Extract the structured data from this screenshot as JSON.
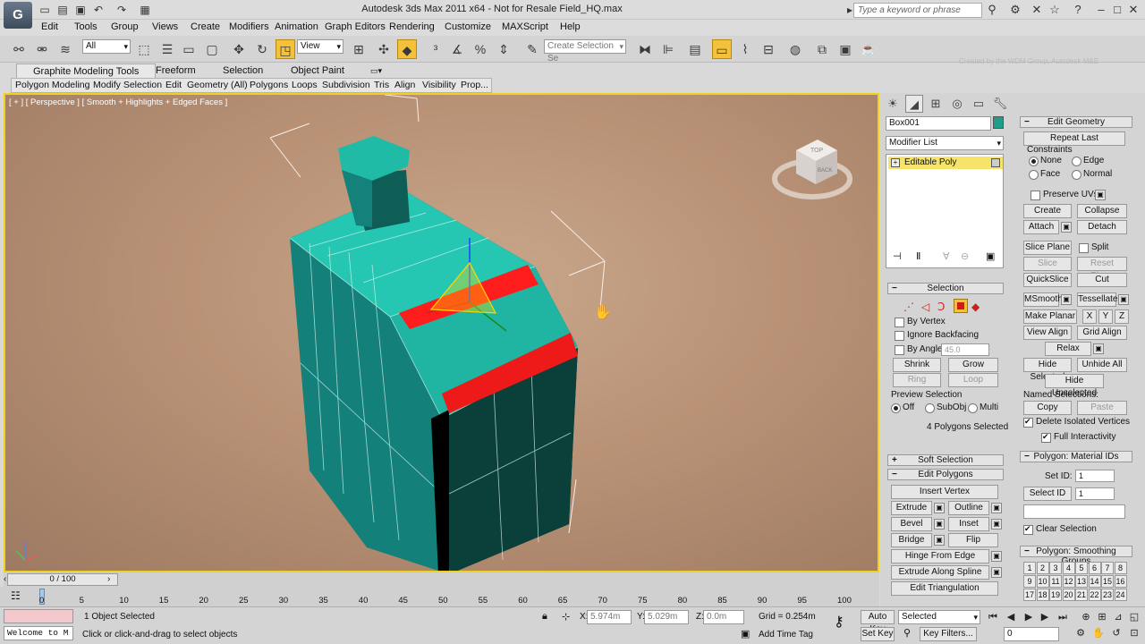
{
  "app": {
    "title": "Autodesk 3ds Max  2011 x64    -  Not for Resale    Field_HQ.max",
    "search_placeholder": "Type a keyword or phrase",
    "watermark": "Created by the WDM Group, Autodesk M&E"
  },
  "menu": [
    "Edit",
    "Tools",
    "Group",
    "Views",
    "Create",
    "Modifiers",
    "Animation",
    "Graph Editors",
    "Rendering",
    "Customize",
    "MAXScript",
    "Help"
  ],
  "toolbar": {
    "filter_value": "All",
    "refcoord_value": "View",
    "selection_set_placeholder": "Create Selection Se"
  },
  "ribbon": {
    "tabs": [
      "Graphite Modeling Tools",
      "Freeform",
      "Selection",
      "Object Paint"
    ],
    "panels": [
      "Polygon Modeling",
      "Modify Selection",
      "Edit",
      "Geometry (All)",
      "Polygons",
      "Loops",
      "Subdivision",
      "Tris",
      "Align",
      "Visibility",
      "Prop..."
    ]
  },
  "viewport": {
    "label_plus": "[ + ]",
    "label_view": "[ Perspective ]",
    "label_shading": "[ Smooth + Highlights + Edged Faces ]",
    "cube_top": "TOP",
    "cube_back": "BACK"
  },
  "timeline": {
    "frame": "0 / 100",
    "ticks": [
      "0",
      "5",
      "10",
      "15",
      "20",
      "25",
      "30",
      "35",
      "40",
      "45",
      "50",
      "55",
      "60",
      "65",
      "70",
      "75",
      "80",
      "85",
      "90",
      "95",
      "100"
    ]
  },
  "status": {
    "maxscript": "Welcome to M",
    "selected": "1 Object Selected",
    "prompt": "Click or click-and-drag to select objects",
    "x_label": "X:",
    "x": "5.974m",
    "y_label": "Y:",
    "y": "5.029m",
    "z_label": "Z:",
    "z": "0.0m",
    "grid": "Grid = 0.254m",
    "add_time_tag": "Add Time Tag",
    "auto_key": "Auto Key",
    "set_key": "Set Key",
    "key_mode": "Selected",
    "key_filters": "Key Filters...",
    "frame_value": "0"
  },
  "command_panel": {
    "object_name": "Box001",
    "object_color": "#1e9e8a",
    "modifier_list": "Modifier List",
    "modifier": "Editable Poly",
    "selection": {
      "title": "Selection",
      "by_vertex": "By Vertex",
      "ignore_backfacing": "Ignore Backfacing",
      "by_angle": "By Angle:",
      "angle": "45.0",
      "shrink": "Shrink",
      "grow": "Grow",
      "ring": "Ring",
      "loop": "Loop",
      "preview": "Preview Selection",
      "off": "Off",
      "subobj": "SubObj",
      "multi": "Multi",
      "count": "4 Polygons Selected"
    },
    "soft_selection": "Soft Selection",
    "edit_polygons": {
      "title": "Edit Polygons",
      "insert_vertex": "Insert Vertex",
      "extrude": "Extrude",
      "outline": "Outline",
      "bevel": "Bevel",
      "inset": "Inset",
      "bridge": "Bridge",
      "flip": "Flip",
      "hinge": "Hinge From Edge",
      "extrude_spline": "Extrude Along Spline",
      "edit_tri": "Edit Triangulation"
    },
    "edit_geometry": {
      "title": "Edit Geometry",
      "repeat_last": "Repeat Last",
      "constraints": "Constraints",
      "none": "None",
      "edge": "Edge",
      "face": "Face",
      "normal": "Normal",
      "preserve_uvs": "Preserve UVs",
      "create": "Create",
      "collapse": "Collapse",
      "attach": "Attach",
      "detach": "Detach",
      "slice_plane": "Slice Plane",
      "split": "Split",
      "slice": "Slice",
      "reset_plane": "Reset Plane",
      "quickslice": "QuickSlice",
      "cut": "Cut",
      "msmooth": "MSmooth",
      "tessellate": "Tessellate",
      "make_planar": "Make Planar",
      "x": "X",
      "y": "Y",
      "z": "Z",
      "view_align": "View Align",
      "grid_align": "Grid Align",
      "relax": "Relax",
      "hide_selected": "Hide Selected",
      "unhide_all": "Unhide All",
      "hide_unselected": "Hide Unselected",
      "named_selections": "Named Selections:",
      "copy": "Copy",
      "paste": "Paste",
      "delete_isolated": "Delete Isolated Vertices",
      "full_interactivity": "Full Interactivity"
    },
    "material_ids": {
      "title": "Polygon: Material IDs",
      "set_id": "Set ID:",
      "set_id_value": "1",
      "select_id": "Select ID",
      "select_id_value": "1",
      "clear_selection": "Clear Selection"
    },
    "smoothing": {
      "title": "Polygon: Smoothing Groups",
      "groups": [
        "1",
        "2",
        "3",
        "4",
        "5",
        "6",
        "7",
        "8",
        "9",
        "10",
        "11",
        "12",
        "13",
        "14",
        "15",
        "16",
        "17",
        "18",
        "19",
        "20",
        "21",
        "22",
        "23",
        "24"
      ]
    }
  }
}
